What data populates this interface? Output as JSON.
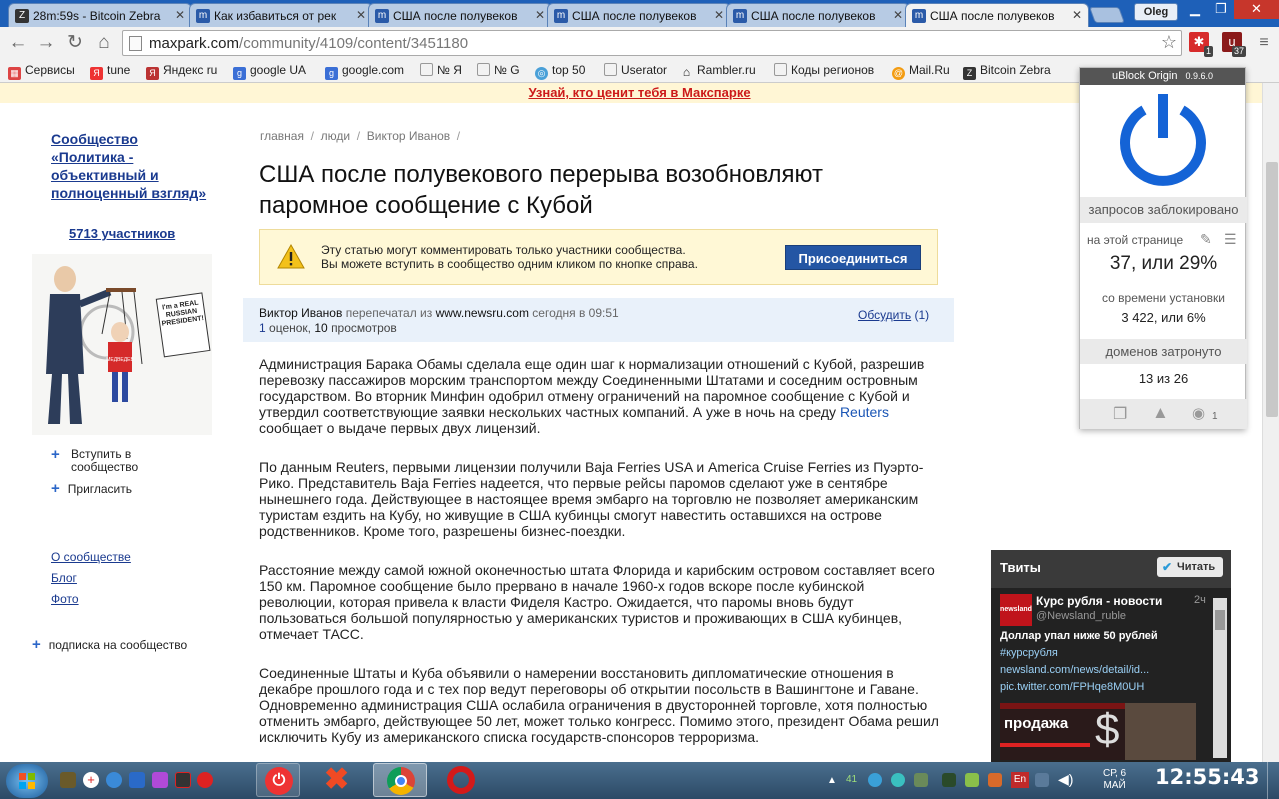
{
  "tabs": [
    {
      "label": "28m:59s - Bitcoin Zebra",
      "active": false
    },
    {
      "label": "Как избавиться от рек",
      "active": false
    },
    {
      "label": "США после полувеков",
      "active": false
    },
    {
      "label": "США после полувеков",
      "active": false
    },
    {
      "label": "США после полувеков",
      "active": false
    },
    {
      "label": "США после полувеков",
      "active": true
    }
  ],
  "user": "Oleg",
  "address": {
    "host": "maxpark.com",
    "path": "/community/4109/content/3451180"
  },
  "extensions": [
    {
      "name": "ext-red",
      "badge": "1"
    },
    {
      "name": "ublock",
      "badge": "37"
    }
  ],
  "bookmarks": [
    "Сервисы",
    "tune",
    "Яндекс ru",
    "google UA",
    "google.com",
    "№ Я",
    "№ G",
    "top 50",
    "Userator",
    "Rambler.ru",
    "Коды регионов",
    "Mail.Ru",
    "Bitcoin Zebra"
  ],
  "promo": "Узнай, кто ценит тебя в Макспарке",
  "sidebar": {
    "community_title": "Сообщество «Политика - объективный и полноценный взгляд»",
    "members": "5713 участников",
    "join_link": "Вступить в сообщество",
    "invite_link": "Пригласить",
    "about": "О сообществе",
    "blog": "Блог",
    "photo": "Фото",
    "subscribe": "подписка на сообщество",
    "cartoon": {
      "sign": "I'm a REAL RUSSIAN PRESIDENT!",
      "tag": "МЕДВЕДЕВ"
    }
  },
  "breadcrumbs": [
    "главная",
    "люди",
    "Виктор Иванов"
  ],
  "article": {
    "title": "США после полувекового перерыва возобновляют паромное сообщение с Кубой",
    "notice_line1": "Эту статью могут комментировать только участники сообщества.",
    "notice_line2": "Вы можете вступить в сообщество одним кликом по кнопке справа.",
    "join_button": "Присоединиться",
    "author": "Виктор Иванов",
    "reprinted_from": "перепечатал из",
    "source": "www.newsru.com",
    "time": "сегодня в 09:51",
    "ratings": "1",
    "ratings_label": "оценок,",
    "views": "10",
    "views_label": "просмотров",
    "discuss": "Обсудить",
    "discuss_count": "(1)",
    "p1": "Администрация Барака Обамы сделала еще один шаг к нормализации отношений с Кубой, разрешив перевозку пассажиров морским транспортом между Соединенными Штатами и соседним островным государством. Во вторник Минфин одобрил отмену ограничений на паромное сообщение с Кубой и утвердил соответствующие заявки нескольких частных компаний. А уже в ночь на среду",
    "p1_link": "Reuters",
    "p1_tail": "сообщает о выдаче первых двух лицензий.",
    "p2": "По данным Reuters, первыми лицензии получили Baja Ferries USA и America Cruise Ferries из Пуэрто-Рико. Представитель Baja Ferries надеется, что первые рейсы паромов сделают уже в сентябре нынешнего года. Действующее в настоящее время эмбарго на торговлю не позволяет американским туристам ездить на Кубу, но живущие в США кубинцы смогут навестить оставшихся на острове родственников. Кроме того, разрешены бизнес-поездки.",
    "p3": "Расстояние между самой южной оконечностью штата Флорида и карибским островом составляет всего 150 км. Паромное сообщение было прервано в начале 1960-х годов вскоре после кубинской революции, которая привела к власти Фиделя Кастро. Ожидается, что паромы вновь будут пользоваться большой популярностью у американских туристов и проживающих в США кубинцев, отмечает ТАСС.",
    "p4": "Соединенные Штаты и Куба объявили о намерении восстановить дипломатические отношения в декабре прошлого года и с тех пор ведут переговоры об открытии посольств в Вашингтоне и Гаване. Одновременно администрация США ослабила ограничения в двусторонней торговле, хотя полностью отменить эмбарго, действующее 50 лет, может только конгресс. Помимо этого, президент Обама решил исключить Кубу из американского списка государств-спонсоров терроризма."
  },
  "ublock": {
    "name": "uBlock Origin",
    "version": "0.9.6.0",
    "blocked_label": "запросов заблокировано",
    "on_page_label": "на этой странице",
    "on_page_value": "37, или 29%",
    "since_install_label": "со времени установки",
    "since_install_value": "3 422, или 6%",
    "domains_label": "доменов затронуто",
    "domains_value": "13 из 26",
    "footer_count": "1"
  },
  "tweets": {
    "title": "Твиты",
    "follow_button": "Читать",
    "account": "Курс рубля - новости",
    "handle": "@Newsland_ruble",
    "age": "2ч",
    "avatar_text": "newsland",
    "text": "Доллар упал ниже 50 рублей",
    "hashtag": "#курсрубля",
    "link1": "newsland.com/news/detail/id...",
    "link2": "pic.twitter.com/FPHqe8M0UH",
    "image_text": "продажа"
  },
  "taskbar": {
    "tray_count": "41",
    "lang": "En",
    "day": "СР, 6",
    "month": "МАЙ",
    "clock": "12:55:43"
  },
  "colors": {
    "tab_strip": "#1e60b8",
    "link": "#1a3a8f",
    "ublock_power": "#1463d6",
    "join_button": "#2456a4",
    "promo": "#cc1a1a"
  }
}
